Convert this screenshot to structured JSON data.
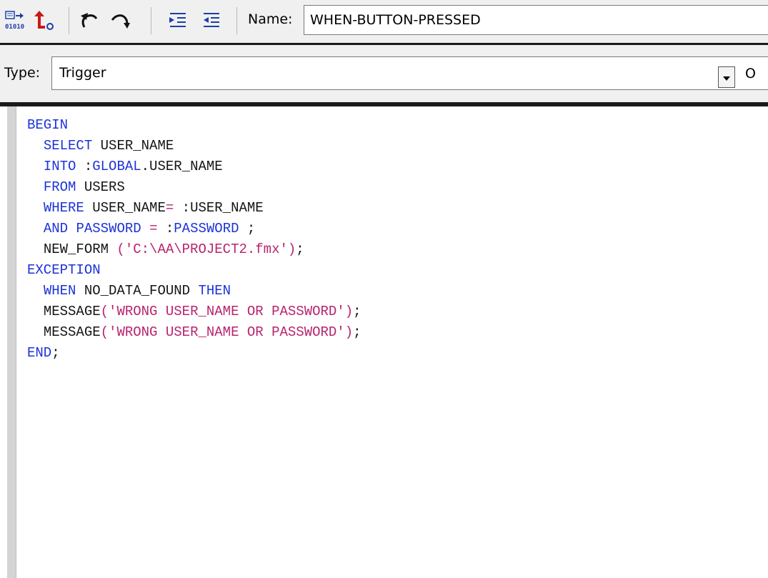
{
  "toolbar": {
    "name_label": "Name:",
    "name_value": "WHEN-BUTTON-PRESSED",
    "icons": [
      "compile-icon",
      "revert-icon",
      "undo-icon",
      "redo-icon",
      "indent-icon",
      "outdent-icon"
    ]
  },
  "typebar": {
    "type_label": "Type:",
    "type_value": "Trigger",
    "cut_label": "O"
  },
  "editor": {
    "lines": [
      {
        "indent": "",
        "tokens": [
          {
            "t": "BEGIN",
            "c": "kw"
          }
        ]
      },
      {
        "indent": "  ",
        "tokens": [
          {
            "t": "SELECT",
            "c": "kw"
          },
          {
            "t": " USER_NAME",
            "c": "plain"
          }
        ]
      },
      {
        "indent": "  ",
        "tokens": [
          {
            "t": "INTO",
            "c": "kw"
          },
          {
            "t": " :",
            "c": "plain"
          },
          {
            "t": "GLOBAL",
            "c": "kw"
          },
          {
            "t": ".USER_NAME",
            "c": "plain"
          }
        ]
      },
      {
        "indent": "  ",
        "tokens": [
          {
            "t": "FROM",
            "c": "kw"
          },
          {
            "t": " USERS",
            "c": "plain"
          }
        ]
      },
      {
        "indent": "  ",
        "tokens": [
          {
            "t": "WHERE",
            "c": "kw"
          },
          {
            "t": " USER_NAME",
            "c": "plain"
          },
          {
            "t": "=",
            "c": "sym"
          },
          {
            "t": " :USER_NAME",
            "c": "plain"
          }
        ]
      },
      {
        "indent": "  ",
        "tokens": [
          {
            "t": "AND",
            "c": "kw"
          },
          {
            "t": " ",
            "c": "plain"
          },
          {
            "t": "PASSWORD",
            "c": "kw"
          },
          {
            "t": " ",
            "c": "plain"
          },
          {
            "t": "=",
            "c": "sym"
          },
          {
            "t": " :",
            "c": "plain"
          },
          {
            "t": "PASSWORD",
            "c": "kw"
          },
          {
            "t": " ;",
            "c": "plain"
          }
        ]
      },
      {
        "indent": "  ",
        "tokens": [
          {
            "t": "NEW_FORM",
            "c": "plain"
          },
          {
            "t": " (",
            "c": "sym"
          },
          {
            "t": "'C:\\AA\\PROJECT2.fmx'",
            "c": "str"
          },
          {
            "t": ")",
            "c": "sym"
          },
          {
            "t": ";",
            "c": "plain"
          }
        ]
      },
      {
        "indent": "",
        "tokens": [
          {
            "t": "EXCEPTION",
            "c": "kw"
          }
        ]
      },
      {
        "indent": "  ",
        "tokens": [
          {
            "t": "WHEN",
            "c": "kw"
          },
          {
            "t": " NO_DATA_FOUND ",
            "c": "plain"
          },
          {
            "t": "THEN",
            "c": "kw"
          }
        ]
      },
      {
        "indent": "  ",
        "tokens": [
          {
            "t": "MESSAGE",
            "c": "plain"
          },
          {
            "t": "(",
            "c": "sym"
          },
          {
            "t": "'WRONG USER_NAME OR PASSWORD'",
            "c": "str"
          },
          {
            "t": ")",
            "c": "sym"
          },
          {
            "t": ";",
            "c": "plain"
          }
        ]
      },
      {
        "indent": "  ",
        "tokens": [
          {
            "t": "MESSAGE",
            "c": "plain"
          },
          {
            "t": "(",
            "c": "sym"
          },
          {
            "t": "'WRONG USER_NAME OR PASSWORD'",
            "c": "str"
          },
          {
            "t": ")",
            "c": "sym"
          },
          {
            "t": ";",
            "c": "plain"
          }
        ]
      },
      {
        "indent": "",
        "tokens": [
          {
            "t": "END",
            "c": "kw"
          },
          {
            "t": ";",
            "c": "plain"
          }
        ]
      }
    ]
  }
}
